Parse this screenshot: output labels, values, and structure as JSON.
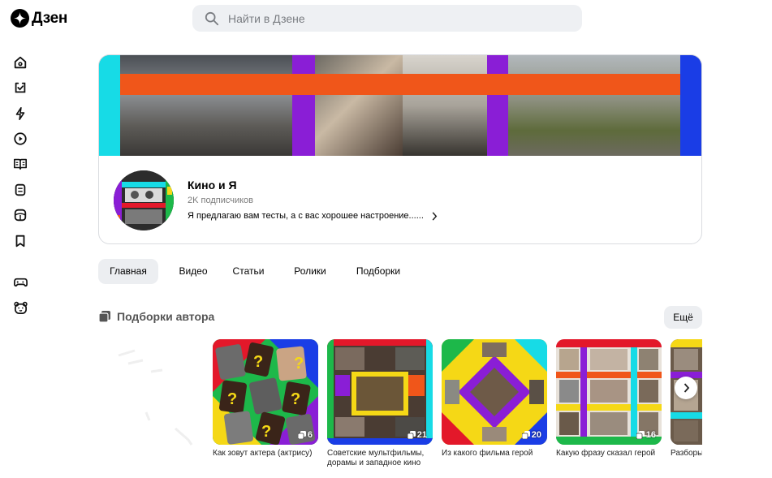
{
  "header": {
    "logo_text": "Дзен",
    "search_placeholder": "Найти в Дзене"
  },
  "sidebar": {
    "items": [
      {
        "icon": "home-icon"
      },
      {
        "icon": "subscriptions-icon"
      },
      {
        "icon": "lightning-icon"
      },
      {
        "icon": "video-play-icon"
      },
      {
        "icon": "book-icon"
      },
      {
        "icon": "tv-icon"
      },
      {
        "icon": "gallery-icon"
      },
      {
        "icon": "bookmark-icon"
      },
      {
        "icon": "gamepad-icon"
      },
      {
        "icon": "kids-bear-icon"
      }
    ]
  },
  "channel": {
    "name": "Кино и Я",
    "subscribers": "2K подписчиков",
    "description": "Я предлагаю вам тесты, а с вас хорошее настроение......"
  },
  "tabs": [
    {
      "label": "Главная",
      "active": true
    },
    {
      "label": "Видео",
      "active": false
    },
    {
      "label": "Статьи",
      "active": false
    },
    {
      "label": "Ролики",
      "active": false
    },
    {
      "label": "Подборки",
      "active": false
    }
  ],
  "collections_section": {
    "title": "Подборки автора",
    "more_label": "Ещё",
    "items": [
      {
        "title": "Как зовут актера (актрису)",
        "count": "6"
      },
      {
        "title": "Советские мультфильмы, дорамы и западное кино",
        "count": "21"
      },
      {
        "title": "Из какого фильма герой",
        "count": "20"
      },
      {
        "title": "Какую фразу сказал герой",
        "count": "16"
      },
      {
        "title": "Разборы",
        "count": ""
      }
    ]
  },
  "colors": {
    "accent_orange": "#f0561a",
    "purple": "#8a1ed6",
    "cyan": "#17dbe6",
    "blue": "#1a3de6",
    "green": "#1db84a",
    "yellow": "#f5d816",
    "red": "#e3182a"
  }
}
